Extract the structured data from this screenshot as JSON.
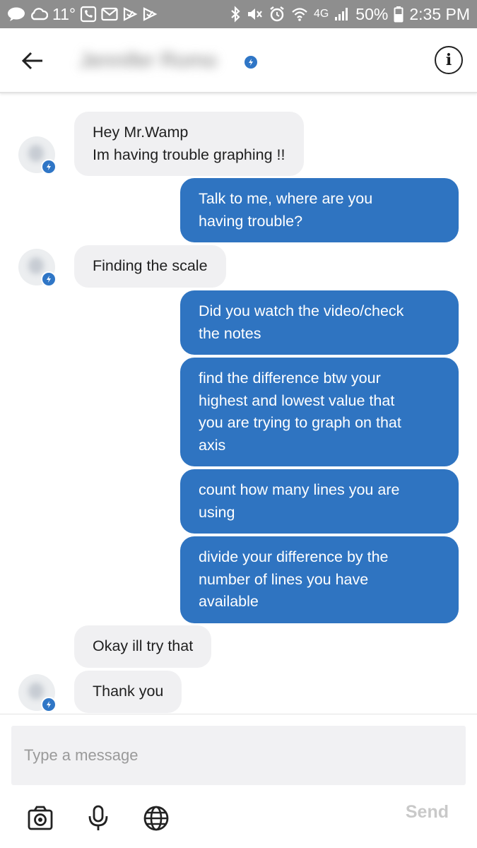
{
  "status_bar": {
    "temperature": "11°",
    "network": "4G",
    "battery": "50%",
    "time": "2:35 PM",
    "left_icons": [
      "message-icon",
      "cloud-icon",
      "phone-message-icon",
      "mail-icon",
      "check-icon",
      "check-icon"
    ],
    "right_icons": [
      "bluetooth-icon",
      "mute-icon",
      "alarm-icon",
      "wifi-icon",
      "signal-icon",
      "battery-icon"
    ]
  },
  "header": {
    "contact_name": "Jennifer Romo",
    "back_icon": "arrow-left-icon",
    "info_icon": "info-icon",
    "badge_color": "#2f76c6"
  },
  "messages": [
    {
      "dir": "in",
      "text": "Hey Mr.Wamp\nIm having trouble graphing !!"
    },
    {
      "dir": "out",
      "text": "Talk to me, where are you\nhaving trouble?"
    },
    {
      "dir": "in",
      "text": "Finding the scale"
    },
    {
      "dir": "out",
      "text": "Did you watch the video/check\nthe notes"
    },
    {
      "dir": "out",
      "text": "find the difference btw your\nhighest and lowest value that\nyou are trying to graph on that\naxis"
    },
    {
      "dir": "out",
      "text": "count how many lines you are\nusing"
    },
    {
      "dir": "out",
      "text": "divide your difference by the\nnumber of lines you have\navailable"
    },
    {
      "dir": "in",
      "text": "Okay ill try that"
    },
    {
      "dir": "in",
      "text": "Thank you"
    }
  ],
  "composer": {
    "placeholder": "Type a message",
    "send_label": "Send",
    "tools": [
      "camera-icon",
      "microphone-icon",
      "globe-icon"
    ]
  },
  "colors": {
    "outgoing_bubble": "#2f74c1",
    "incoming_bubble": "#f0f0f2",
    "status_bar": "#8e8e8e"
  }
}
